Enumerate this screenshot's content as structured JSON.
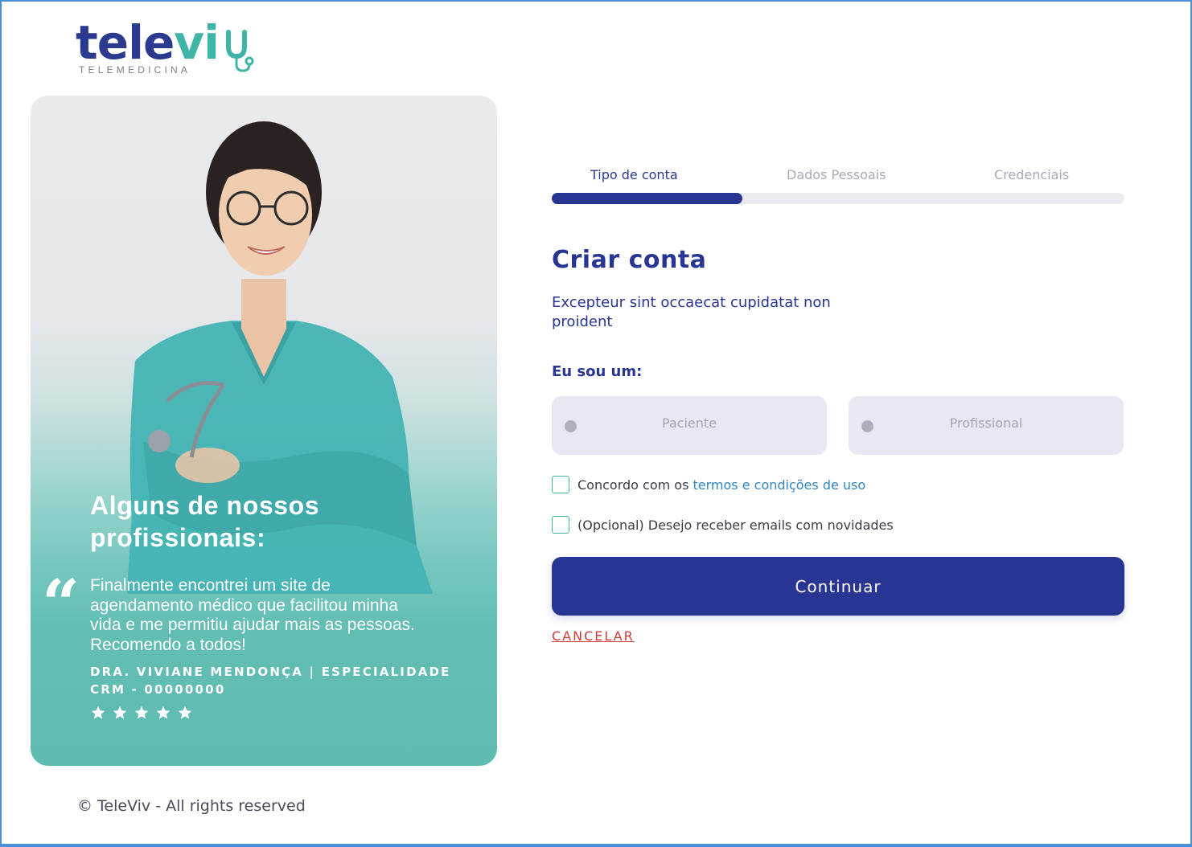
{
  "brand": {
    "name_primary": "tele",
    "name_accent": "vi",
    "tagline": "TELEMEDICINA",
    "primary_color": "#293593",
    "accent_color": "#3fb5a8"
  },
  "hero": {
    "title": "Alguns de nossos profissionais:",
    "quote_mark": "“",
    "quote": "Finalmente encontrei um site de agendamento médico que facilitou minha vida e me permitiu ajudar mais as pessoas. Recomendo a todos!",
    "author_line1": "DRA. VIVIANE MENDONÇA | ESPECIALIDADE",
    "author_line2": "CRM - 00000000",
    "rating": 5,
    "rating_max": 5,
    "photo_icon": "doctor-portrait"
  },
  "footer": {
    "copyright": "© TeleViv - All rights reserved"
  },
  "steps": {
    "items": [
      {
        "label": "Tipo de conta"
      },
      {
        "label": "Dados Pessoais"
      },
      {
        "label": "Credenciais"
      }
    ],
    "current": 1,
    "progress_fraction": 0.333
  },
  "form": {
    "title": "Criar conta",
    "subtitle": "Excepteur sint occaecat cupidatat non proident",
    "account_type_label": "Eu sou um:",
    "options": [
      {
        "label": "Paciente"
      },
      {
        "label": "Profissional"
      }
    ],
    "terms_prefix": "Concordo com os",
    "terms_link": "termos e condições de uso",
    "newsletter": "(Opcional) Desejo receber emails com novidades",
    "continue_label": "Continuar",
    "cancel_label": "CANCELAR",
    "cancel_color": "#d33a3a"
  }
}
